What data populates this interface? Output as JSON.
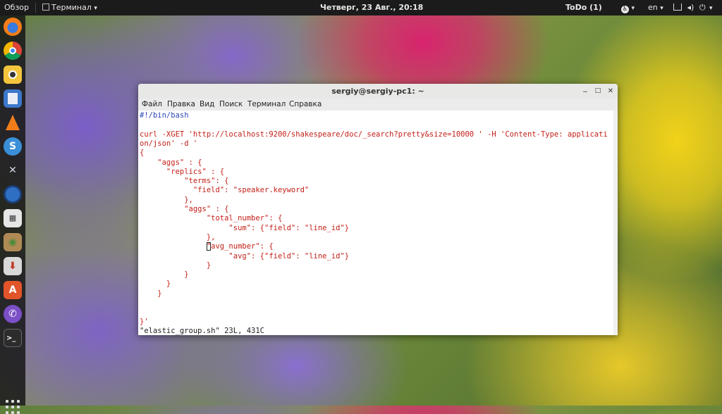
{
  "topbar": {
    "activities": "Обзор",
    "app_menu": "Терминал",
    "app_menu_arrow": "▾",
    "clock": "Четверг, 23 Авг., 20:18",
    "todo": "ToDo (1)",
    "accessibility_arrow": "▾",
    "lang": "en",
    "lang_arrow": "▾",
    "system_arrow": "▾"
  },
  "dock": {
    "items": [
      "firefox",
      "chrome",
      "rhythmbox",
      "files",
      "vlc",
      "simplenote",
      "settings-tools",
      "thunderbird",
      "calculator",
      "file-manager",
      "install",
      "software-center",
      "viber",
      "terminal"
    ]
  },
  "window": {
    "title": "sergiy@sergiy-pc1: ~",
    "minimize": "‒",
    "maximize": "□",
    "close": "✕",
    "menus": [
      "Файл",
      "Правка",
      "Вид",
      "Поиск",
      "Терминал",
      "Справка"
    ]
  },
  "terminal": {
    "lines": [
      {
        "text": "#!/bin/bash",
        "color": "#2a46b8"
      },
      {
        "text": "",
        "color": "#222222"
      },
      {
        "text": "curl -XGET 'http://localhost:9200/shakespeare/doc/_search?pretty&size=10000 ' -H 'Content-Type: applicati",
        "color": "#c21f17"
      },
      {
        "text": "on/json' -d '",
        "color": "#c21f17"
      },
      {
        "text": "{",
        "color": "#c21f17"
      },
      {
        "text": "    \"aggs\" : {",
        "color": "#c21f17"
      },
      {
        "text": "      \"replics\" : {",
        "color": "#c21f17"
      },
      {
        "text": "          \"terms\": {",
        "color": "#c21f17"
      },
      {
        "text": "            \"field\": \"speaker.keyword\"",
        "color": "#c21f17"
      },
      {
        "text": "          },",
        "color": "#c21f17"
      },
      {
        "text": "          \"aggs\" : {",
        "color": "#c21f17"
      },
      {
        "text": "               \"total_number\": {",
        "color": "#c21f17"
      },
      {
        "text": "                    \"sum\": {\"field\": \"line_id\"}",
        "color": "#c21f17"
      },
      {
        "text": "               },",
        "color": "#c21f17"
      },
      {
        "text": "               \"avg_number\": {",
        "color": "#c21f17"
      },
      {
        "text": "                    \"avg\": {\"field\": \"line_id\"}",
        "color": "#c21f17"
      },
      {
        "text": "               }",
        "color": "#c21f17"
      },
      {
        "text": "          }",
        "color": "#c21f17"
      },
      {
        "text": "      }",
        "color": "#c21f17"
      },
      {
        "text": "    }",
        "color": "#c21f17"
      },
      {
        "text": "",
        "color": "#222222"
      },
      {
        "text": "",
        "color": "#222222"
      },
      {
        "text": "}'",
        "color": "#c21f17"
      },
      {
        "text": "\"elastic_group.sh\" 23L, 431C",
        "color": "#222222"
      }
    ]
  }
}
